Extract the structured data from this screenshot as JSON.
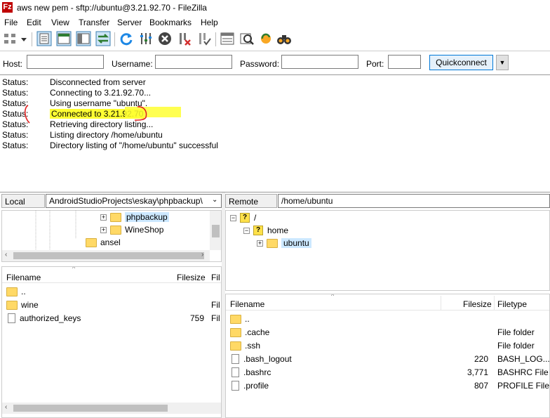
{
  "window": {
    "title": "aws new pem - sftp://ubuntu@3.21.92.70 - FileZilla",
    "app_icon": "Fz"
  },
  "menu": [
    "File",
    "Edit",
    "View",
    "Transfer",
    "Server",
    "Bookmarks",
    "Help"
  ],
  "toolbar": {
    "buttons": [
      "site-manager-icon",
      "site-manager-dropdown-icon",
      "toggle-message-log-icon",
      "toggle-local-tree-icon",
      "toggle-remote-tree-icon",
      "toggle-transfer-queue-icon",
      "refresh-icon",
      "process-queue-icon",
      "cancel-icon",
      "disconnect-icon",
      "reconnect-icon",
      "directory-listing-filters-icon",
      "toggle-filter-icon",
      "synchronized-browsing-icon",
      "search-remote-icon"
    ]
  },
  "quickconnect": {
    "host_label": "Host:",
    "username_label": "Username:",
    "password_label": "Password:",
    "port_label": "Port:",
    "host_value": "",
    "username_value": "",
    "password_value": "",
    "port_value": "",
    "button_label": "Quickconnect",
    "dropdown_arrow": "▼"
  },
  "log": [
    {
      "type": "Status:",
      "message": "Disconnected from server"
    },
    {
      "type": "Status:",
      "message": "Connecting to 3.21.92.70..."
    },
    {
      "type": "Status:",
      "message": "Using username \"ubuntu\"."
    },
    {
      "type": "Status:",
      "message": "Connected to 3.21.92.70"
    },
    {
      "type": "Status:",
      "message": "Retrieving directory listing..."
    },
    {
      "type": "Status:",
      "message": "Listing directory /home/ubuntu"
    },
    {
      "type": "Status:",
      "message": "Directory listing of \"/home/ubuntu\" successful"
    }
  ],
  "highlight_color": "#ffff33",
  "annotation_color": "#e02020",
  "local": {
    "site_label": "Local site:",
    "path": "AndroidStudioProjects\\eskay\\phpbackup\\",
    "tree": [
      {
        "label": "phpbackup",
        "expander": "+"
      },
      {
        "label": "WineShop",
        "expander": "+"
      },
      {
        "label": "ansel",
        "expander": ""
      }
    ],
    "columns": [
      "Filename",
      "Filesize",
      "Fil"
    ],
    "files": [
      {
        "name": "..",
        "size": "",
        "type": "",
        "icon": "folder-icon"
      },
      {
        "name": "wine",
        "size": "",
        "type": "Fil",
        "icon": "folder-icon"
      },
      {
        "name": "authorized_keys",
        "size": "759",
        "type": "Fil",
        "icon": "file-icon"
      }
    ]
  },
  "remote": {
    "site_label": "Remote site:",
    "path": "/home/ubuntu",
    "tree": [
      {
        "label": "/",
        "expander": "−"
      },
      {
        "label": "home",
        "expander": "−"
      },
      {
        "label": "ubuntu",
        "expander": "+"
      }
    ],
    "columns": [
      "Filename",
      "Filesize",
      "Filetype"
    ],
    "files": [
      {
        "name": "..",
        "size": "",
        "type": "",
        "icon": "folder-icon"
      },
      {
        "name": ".cache",
        "size": "",
        "type": "File folder",
        "icon": "folder-icon"
      },
      {
        "name": ".ssh",
        "size": "",
        "type": "File folder",
        "icon": "folder-icon"
      },
      {
        "name": ".bash_logout",
        "size": "220",
        "type": "BASH_LOG...",
        "icon": "file-icon"
      },
      {
        "name": ".bashrc",
        "size": "3,771",
        "type": "BASHRC File",
        "icon": "file-icon"
      },
      {
        "name": ".profile",
        "size": "807",
        "type": "PROFILE File",
        "icon": "file-icon"
      }
    ]
  }
}
